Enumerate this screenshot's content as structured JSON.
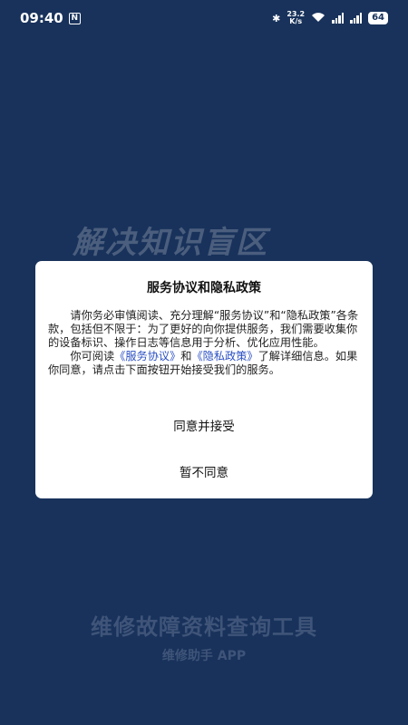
{
  "status_bar": {
    "time": "09:40",
    "nfc_icon": "N",
    "speed_value": "23.2",
    "speed_unit": "K/s",
    "battery": "64"
  },
  "background": {
    "slogan": "解决知识盲区",
    "app_title": "维修故障资料查询工具",
    "app_subtitle": "维修助手 APP"
  },
  "dialog": {
    "title": "服务协议和隐私政策",
    "para1": "请你务必审慎阅读、充分理解“服务协议”和“隐私政策”各条款，包括但不限于：为了更好的向你提供服务，我们需要收集你的设备标识、操作日志等信息用于分析、优化应用性能。",
    "para2_prefix": "你可阅读",
    "link_service": "《服务协议》",
    "para2_and": "和",
    "link_privacy": "《隐私政策》",
    "para2_suffix": "了解详细信息。如果你同意，请点击下面按钮开始接受我们的服务。",
    "accept_label": "同意并接受",
    "decline_label": "暂不同意"
  },
  "colors": {
    "background": "#18325b",
    "dialog": "#ffffff",
    "link": "#2a4fc2"
  }
}
